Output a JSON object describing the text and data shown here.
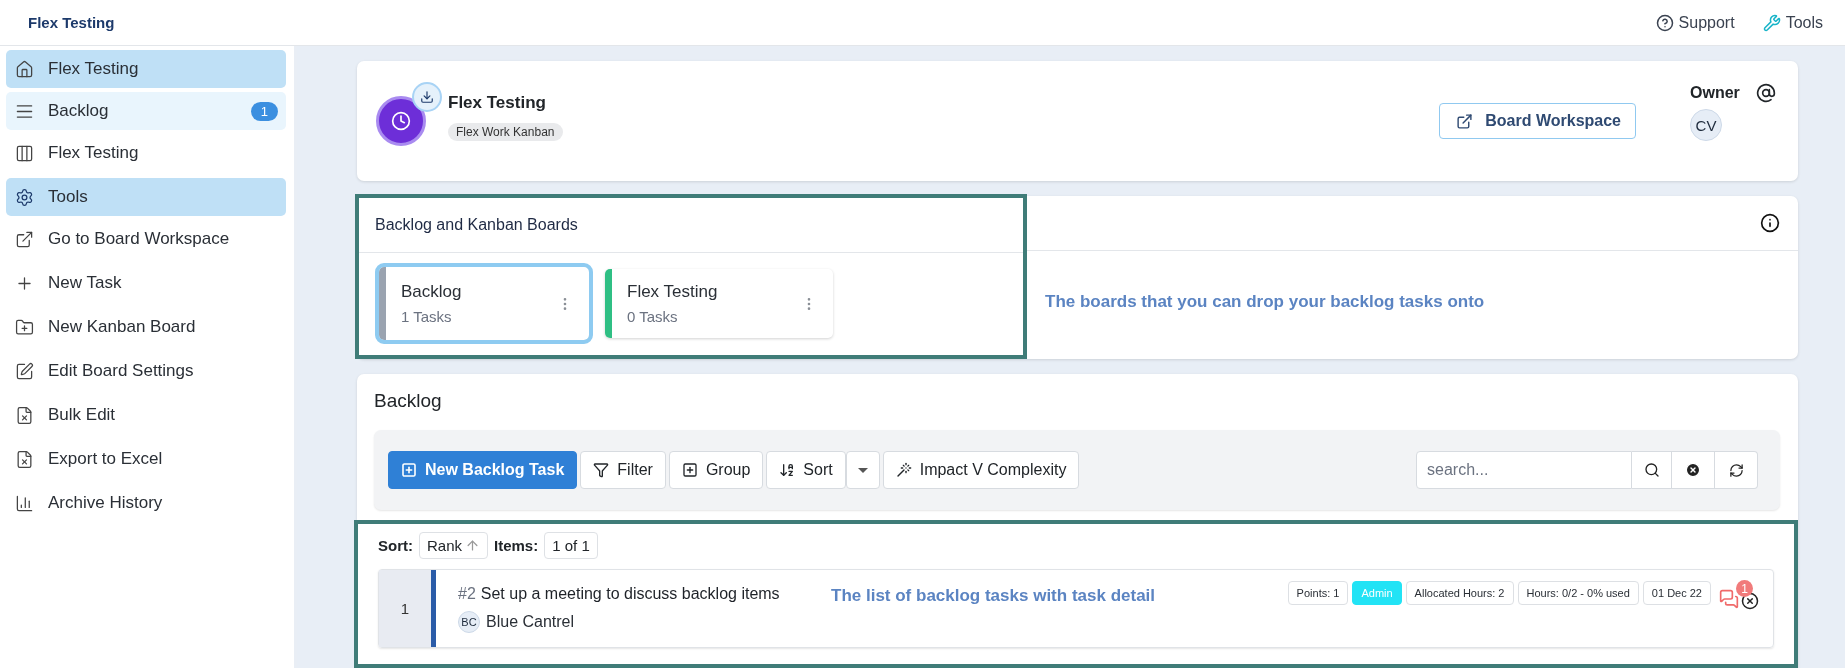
{
  "top_bar": {
    "title": "Flex Testing",
    "links": [
      {
        "label": "Support"
      },
      {
        "label": "Tools"
      }
    ]
  },
  "sidebar": {
    "items": [
      {
        "label": "Flex Testing",
        "selected": true,
        "current": false
      },
      {
        "label": "Backlog",
        "selected": false,
        "current": true,
        "badge": "1"
      },
      {
        "label": "Flex Testing",
        "selected": false,
        "current": false
      },
      {
        "label": "Tools",
        "selected": true,
        "current": false
      },
      {
        "label": "Go to Board Workspace",
        "selected": false,
        "current": false
      },
      {
        "label": "New Task",
        "selected": false,
        "current": false
      },
      {
        "label": "New Kanban Board",
        "selected": false,
        "current": false
      },
      {
        "label": "Edit Board Settings",
        "selected": false,
        "current": false
      },
      {
        "label": "Bulk Edit",
        "selected": false,
        "current": false
      },
      {
        "label": "Export to Excel",
        "selected": false,
        "current": false
      },
      {
        "label": "Archive History",
        "selected": false,
        "current": false
      }
    ]
  },
  "header": {
    "title": "Flex Testing",
    "tag": "Flex Work Kanban",
    "button": "Board Workspace",
    "owner_label": "Owner",
    "owner_initials": "CV"
  },
  "boards": {
    "title": "Backlog and Kanban Boards",
    "note": "The boards that you can drop your backlog tasks onto",
    "items": [
      {
        "name": "Backlog",
        "count": "1 Tasks",
        "color": "#9aa3b0",
        "selected": true
      },
      {
        "name": "Flex Testing",
        "count": "0 Tasks",
        "color": "#2fbf84",
        "selected": false
      }
    ]
  },
  "backlog": {
    "title": "Backlog",
    "toolbar": [
      {
        "label": "New Backlog Task",
        "kind": "primary"
      },
      {
        "label": "Filter",
        "kind": "filter"
      },
      {
        "label": "Group",
        "kind": "group"
      },
      {
        "label": "Sort",
        "kind": "sort"
      },
      {
        "label": "Impact V Complexity",
        "kind": "wand"
      }
    ],
    "search": {
      "placeholder": "search..."
    },
    "sort_label": "Sort:",
    "sort_value": "Rank",
    "items_label": "Items:",
    "items_value": "1 of 1",
    "note": "The list of backlog tasks with task detail",
    "tasks": [
      {
        "rank": "1",
        "number": "#2",
        "title": "Set up a meeting to discuss backlog items",
        "initials": "BC",
        "assignee": "Blue Cantrel",
        "comments": "1",
        "chips": [
          {
            "label": "Points: 1",
            "kind": "plain"
          },
          {
            "label": "Admin",
            "kind": "role"
          },
          {
            "label": "Allocated Hours: 2",
            "kind": "plain"
          },
          {
            "label": "Hours: 0/2 - 0% used",
            "kind": "plain"
          },
          {
            "label": "01 Dec 22",
            "kind": "plain"
          }
        ]
      }
    ]
  }
}
